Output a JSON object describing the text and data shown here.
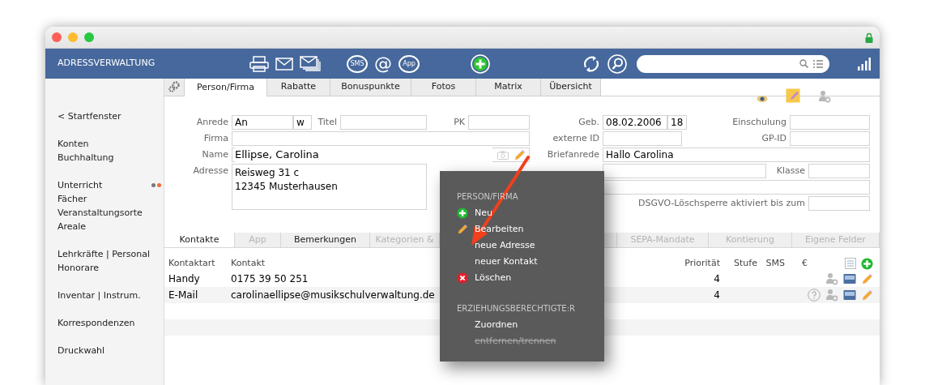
{
  "window": {
    "title": "ADRESSVERWALTUNG"
  },
  "toolbar": {
    "groups": [
      [
        {
          "kind": "printer"
        },
        {
          "kind": "mail"
        },
        {
          "kind": "mail-stack"
        }
      ],
      [
        {
          "kind": "bubble",
          "label": "SMS"
        },
        {
          "kind": "at",
          "label": "@"
        },
        {
          "kind": "bubble",
          "label": "App"
        }
      ],
      [
        {
          "kind": "add"
        }
      ],
      [
        {
          "kind": "refresh"
        },
        {
          "kind": "zoom"
        }
      ]
    ]
  },
  "sidebar": {
    "groups": [
      [
        {
          "label": "< Startfenster",
          "flag": false
        }
      ],
      [
        {
          "label": "Konten",
          "flag": false
        },
        {
          "label": "Buchhaltung",
          "flag": false
        }
      ],
      [
        {
          "label": "Unterricht",
          "flag": true
        },
        {
          "label": "Fächer",
          "flag": false
        },
        {
          "label": "Veranstaltungsorte",
          "flag": false
        },
        {
          "label": "Areale",
          "flag": false
        }
      ],
      [
        {
          "label": "Lehrkräfte | Personal",
          "flag": false
        },
        {
          "label": "Honorare",
          "flag": false
        }
      ],
      [
        {
          "label": "Inventar | Instrum.",
          "flag": false
        }
      ],
      [
        {
          "label": "Korrespondenzen",
          "flag": false
        }
      ],
      [
        {
          "label": "Druckwahl",
          "flag": false
        }
      ]
    ]
  },
  "tabs": [
    {
      "label": "Person/Firma",
      "selected": true
    },
    {
      "label": "Rabatte",
      "selected": false
    },
    {
      "label": "Bonuspunkte",
      "selected": false
    },
    {
      "label": "Fotos",
      "selected": false
    },
    {
      "label": "Matrix",
      "selected": false
    },
    {
      "label": "Übersicht",
      "selected": false
    }
  ],
  "form_left": {
    "anrede": {
      "label": "Anrede",
      "value": "An",
      "gender": "w"
    },
    "titel": {
      "label": "Titel"
    },
    "pk": {
      "label": "PK"
    },
    "firma": {
      "label": "Firma"
    },
    "name": {
      "label": "Name",
      "value": "Ellipse, Carolina"
    },
    "adresse": {
      "label": "Adresse",
      "value": "Reisweg 31 c\n12345 Musterhausen"
    }
  },
  "form_right": {
    "geb": {
      "label": "Geb.",
      "value": "08.02.2006",
      "age": "18"
    },
    "einschulung": {
      "label": "Einschulung"
    },
    "externe_id": {
      "label": "externe ID"
    },
    "gp_id": {
      "label": "GP-ID"
    },
    "briefanrede": {
      "label": "Briefanrede",
      "value": "Hallo Carolina"
    },
    "klasse": {
      "label": "Klasse"
    },
    "dsgvo": {
      "label": "DSGVO-Löschsperre aktiviert bis zum"
    }
  },
  "contact_tabs": [
    {
      "label": "Kontakte",
      "selected": true,
      "disabled": false
    },
    {
      "label": "App",
      "selected": false,
      "disabled": true
    },
    {
      "label": "Bemerkungen",
      "selected": false,
      "disabled": false
    },
    {
      "label": "Kategorien &",
      "selected": false,
      "disabled": true
    },
    {
      "label": "SEPA-Mandate",
      "selected": false,
      "disabled": true
    },
    {
      "label": "Kontierung",
      "selected": false,
      "disabled": true
    },
    {
      "label": "Eigene Felder",
      "selected": false,
      "disabled": true
    }
  ],
  "contacts": {
    "columns": [
      "Kontaktart",
      "Kontakt",
      "Priorität",
      "Stufe",
      "SMS",
      "€"
    ],
    "rows": [
      {
        "type": "Handy",
        "contact": "0175 39 50 251",
        "priority": "4",
        "hint": false
      },
      {
        "type": "E-Mail",
        "contact": "carolinaellipse@musikschulverwaltung.de",
        "priority": "4",
        "hint": true
      }
    ]
  },
  "context_menu": {
    "items": [
      {
        "kind": "heading",
        "label": "PERSON/FIRMA"
      },
      {
        "kind": "add",
        "label": "Neu",
        "disabled": false
      },
      {
        "kind": "edit",
        "label": "Bearbeiten",
        "disabled": false
      },
      {
        "kind": "plain",
        "label": "neue Adresse",
        "disabled": false
      },
      {
        "kind": "plain",
        "label": "neuer Kontakt",
        "disabled": false
      },
      {
        "kind": "delete",
        "label": "Löschen",
        "disabled": false
      },
      {
        "kind": "heading",
        "label": "ERZIEHUNGSBERECHTIGTE:R"
      },
      {
        "kind": "plain",
        "label": "Zuordnen",
        "disabled": false
      },
      {
        "kind": "plain",
        "label": "entfernen/trennen",
        "disabled": true
      }
    ]
  }
}
